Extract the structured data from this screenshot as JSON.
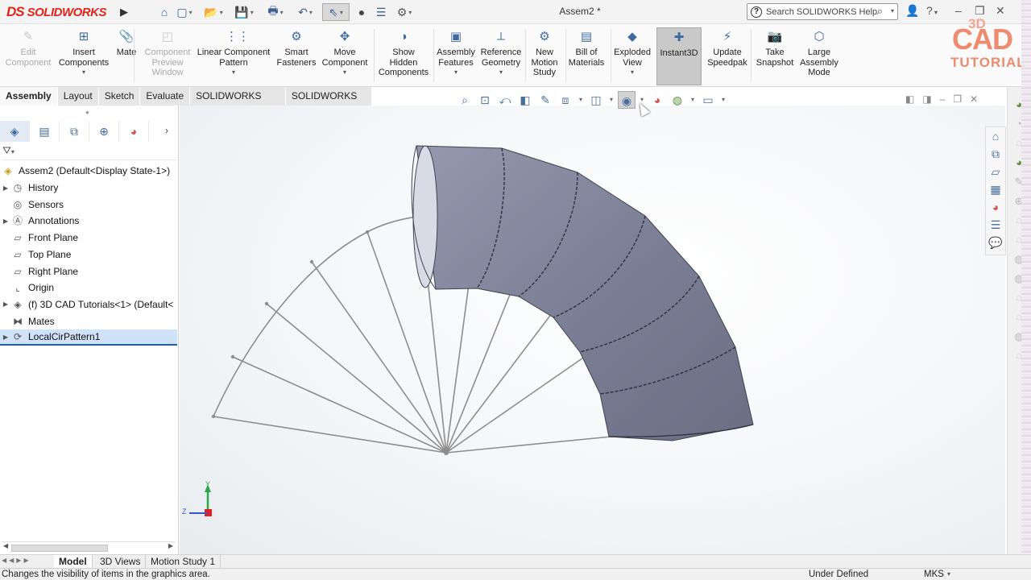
{
  "app": {
    "brand_ds": "DS",
    "brand_name": "SOLIDWORKS",
    "document_title": "Assem2 *"
  },
  "search": {
    "placeholder": "Search SOLIDWORKS Help"
  },
  "watermark": {
    "line1": "3D",
    "line2": "CAD",
    "line3": "TUTORIAL"
  },
  "ribbon": {
    "buttons": [
      {
        "id": "edit-component",
        "label": "Edit\nComponent",
        "icon": "edit-component-icon",
        "enabled": false
      },
      {
        "id": "insert-components",
        "label": "Insert\nComponents",
        "icon": "insert-components-icon",
        "enabled": true
      },
      {
        "id": "mate",
        "label": "Mate",
        "icon": "mate-icon",
        "enabled": true
      },
      {
        "id": "component-preview-window",
        "label": "Component\nPreview\nWindow",
        "icon": "component-preview-icon",
        "enabled": false
      },
      {
        "id": "linear-component-pattern",
        "label": "Linear Component\nPattern",
        "icon": "linear-pattern-icon",
        "enabled": true
      },
      {
        "id": "smart-fasteners",
        "label": "Smart\nFasteners",
        "icon": "smart-fasteners-icon",
        "enabled": true
      },
      {
        "id": "move-component",
        "label": "Move\nComponent",
        "icon": "move-component-icon",
        "enabled": true
      },
      {
        "id": "show-hidden-components",
        "label": "Show\nHidden\nComponents",
        "icon": "show-hidden-icon",
        "enabled": true
      },
      {
        "id": "assembly-features",
        "label": "Assembly\nFeatures",
        "icon": "assembly-features-icon",
        "enabled": true
      },
      {
        "id": "reference-geometry",
        "label": "Reference\nGeometry",
        "icon": "reference-geometry-icon",
        "enabled": true
      },
      {
        "id": "new-motion-study",
        "label": "New\nMotion\nStudy",
        "icon": "motion-study-icon",
        "enabled": true
      },
      {
        "id": "bill-of-materials",
        "label": "Bill of\nMaterials",
        "icon": "bom-icon",
        "enabled": true
      },
      {
        "id": "exploded-view",
        "label": "Exploded\nView",
        "icon": "exploded-view-icon",
        "enabled": true
      },
      {
        "id": "instant3d",
        "label": "Instant3D",
        "icon": "instant3d-icon",
        "enabled": true,
        "active": true
      },
      {
        "id": "update-speedpak",
        "label": "Update\nSpeedpak",
        "icon": "speedpak-icon",
        "enabled": true
      },
      {
        "id": "take-snapshot",
        "label": "Take\nSnapshot",
        "icon": "snapshot-icon",
        "enabled": true
      },
      {
        "id": "large-assembly-mode",
        "label": "Large\nAssembly\nMode",
        "icon": "large-assembly-icon",
        "enabled": true
      }
    ]
  },
  "tabs": [
    "Assembly",
    "Layout",
    "Sketch",
    "Evaluate",
    "SOLIDWORKS Add-Ins",
    "SOLIDWORKS MBD"
  ],
  "feature_tree": {
    "root": "Assem2  (Default<Display State-1>)",
    "items": [
      {
        "label": "History",
        "icon": "history-icon",
        "expandable": true
      },
      {
        "label": "Sensors",
        "icon": "sensors-icon",
        "expandable": false
      },
      {
        "label": "Annotations",
        "icon": "annotations-icon",
        "expandable": true
      },
      {
        "label": "Front Plane",
        "icon": "plane-icon",
        "expandable": false
      },
      {
        "label": "Top Plane",
        "icon": "plane-icon",
        "expandable": false
      },
      {
        "label": "Right Plane",
        "icon": "plane-icon",
        "expandable": false
      },
      {
        "label": "Origin",
        "icon": "origin-icon",
        "expandable": false
      },
      {
        "label": "(f) 3D CAD Tutorials<1> (Default<",
        "icon": "part-icon",
        "expandable": true
      },
      {
        "label": "Mates",
        "icon": "mates-icon",
        "expandable": false
      },
      {
        "label": "LocalCirPattern1",
        "icon": "circular-pattern-icon",
        "expandable": true,
        "selected": true
      }
    ]
  },
  "triad": {
    "x": "Z",
    "y": "Y"
  },
  "bottom_tabs": [
    "Model",
    "3D Views",
    "Motion Study 1"
  ],
  "status": {
    "message": "Changes the visibility of items in the graphics area.",
    "state": "Under Defined",
    "units": "MKS"
  },
  "colors": {
    "pipe": "#7d8199",
    "brand": "#e2231a",
    "accent": "#3d6aa0",
    "selection": "#1b5fb4"
  }
}
